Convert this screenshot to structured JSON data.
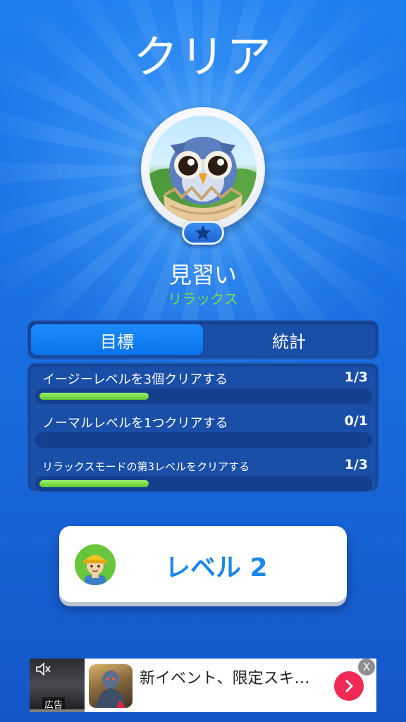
{
  "header": {
    "title": "クリア"
  },
  "player": {
    "avatar_icon": "owl-in-egg-icon",
    "badge_icon": "star-icon",
    "rank": "見習い",
    "mode": "リラックス"
  },
  "tabs": [
    {
      "label": "目標",
      "active": true
    },
    {
      "label": "統計",
      "active": false
    }
  ],
  "goals": [
    {
      "text": "イージーレベルを3個クリアする",
      "count": "1/3",
      "progress": 0.333
    },
    {
      "text": "ノーマルレベルを1つクリアする",
      "count": "0/1",
      "progress": 0.0
    },
    {
      "text": "リラックスモードの第3レベルをクリアする",
      "count": "1/3",
      "progress": 0.333
    }
  ],
  "next_level": {
    "label": "レベル 2",
    "avatar_icon": "construction-worker-icon"
  },
  "ad": {
    "tag": "広告",
    "mute_icon": "speaker-mute-icon",
    "game_icon": "game-app-icon",
    "text": "新イベント、限定スキ…",
    "go_icon": "chevron-right-icon",
    "close": "X"
  },
  "colors": {
    "background": "#1a6fe2",
    "accent_green": "#7ddc4a",
    "progress_green": "#5fc92e",
    "level_text": "#1a86ee",
    "ad_button": "#f02a55"
  }
}
